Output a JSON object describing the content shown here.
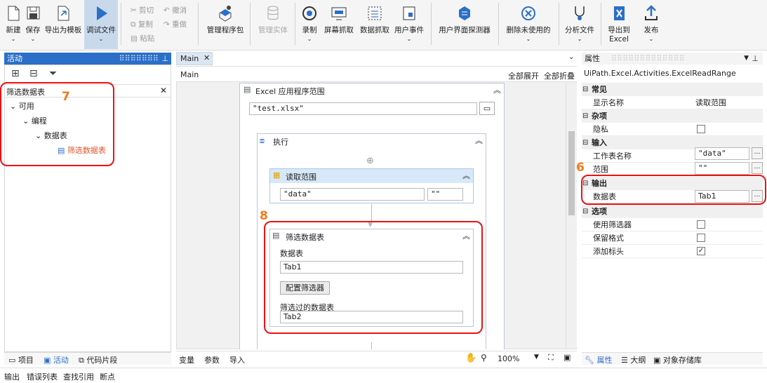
{
  "ribbon": {
    "new": "新建",
    "save": "保存",
    "export_template": "导出为模板",
    "debug_file": "调试文件",
    "cut": "剪切",
    "copy": "复制",
    "paste": "粘贴",
    "undo": "撤消",
    "redo": "重做",
    "manage_packages": "管理程序包",
    "manage_entities": "管理实体",
    "record": "录制",
    "screen_scraping": "屏幕抓取",
    "data_scraping": "数据抓取",
    "user_events": "用户事件",
    "ui_explorer": "用户界面探测器",
    "remove_unused": "删除未使用的",
    "analyze_file": "分析文件",
    "export_excel_1": "导出到",
    "export_excel_2": "Excel",
    "publish": "发布"
  },
  "activities": {
    "title": "活动",
    "search_value": "筛选数据表",
    "tree": [
      "可用",
      "编程",
      "数据表",
      "筛选数据表"
    ],
    "tabs": [
      "项目",
      "活动",
      "代码片段"
    ]
  },
  "designer": {
    "tab": "Main",
    "breadcrumb": "Main",
    "expand_all": "全部展开",
    "collapse_all": "全部折叠",
    "excel_scope": "Excel 应用程序范围",
    "file_path": "\"test.xlsx\"",
    "do": "执行",
    "read_range": "读取范围",
    "rr_sheet": "\"data\"",
    "rr_range": "\"\"",
    "filter": "筛选数据表",
    "dt_label": "数据表",
    "dt_value": "Tab1",
    "config_btn": "配置筛选器",
    "out_label": "筛选过的数据表",
    "out_value": "Tab2",
    "bottom_tabs": [
      "变量",
      "参数",
      "导入"
    ],
    "zoom": "100%"
  },
  "properties": {
    "title": "属性",
    "class": "UiPath.Excel.Activities.ExcelReadRange",
    "sec_common": "常见",
    "display_name_k": "显示名称",
    "display_name_v": "读取范围",
    "sec_misc": "杂项",
    "private_k": "隐私",
    "sec_input": "输入",
    "sheet_k": "工作表名称",
    "sheet_v": "\"data\"",
    "range_k": "范围",
    "range_v": "\"\"",
    "sec_output": "输出",
    "dt_k": "数据表",
    "dt_v": "Tab1",
    "sec_options": "选项",
    "use_filter_k": "使用筛选器",
    "keep_format_k": "保留格式",
    "add_headers_k": "添加标头",
    "tabs": [
      "属性",
      "大纲",
      "对象存储库"
    ]
  },
  "status_bar": [
    "输出",
    "错误列表",
    "查找引用",
    "断点"
  ],
  "annotations": [
    "7",
    "8",
    "6"
  ],
  "colors": {
    "accent": "#2b6fc9",
    "highlight": "#e11111",
    "annotation": "#f27a1a"
  }
}
